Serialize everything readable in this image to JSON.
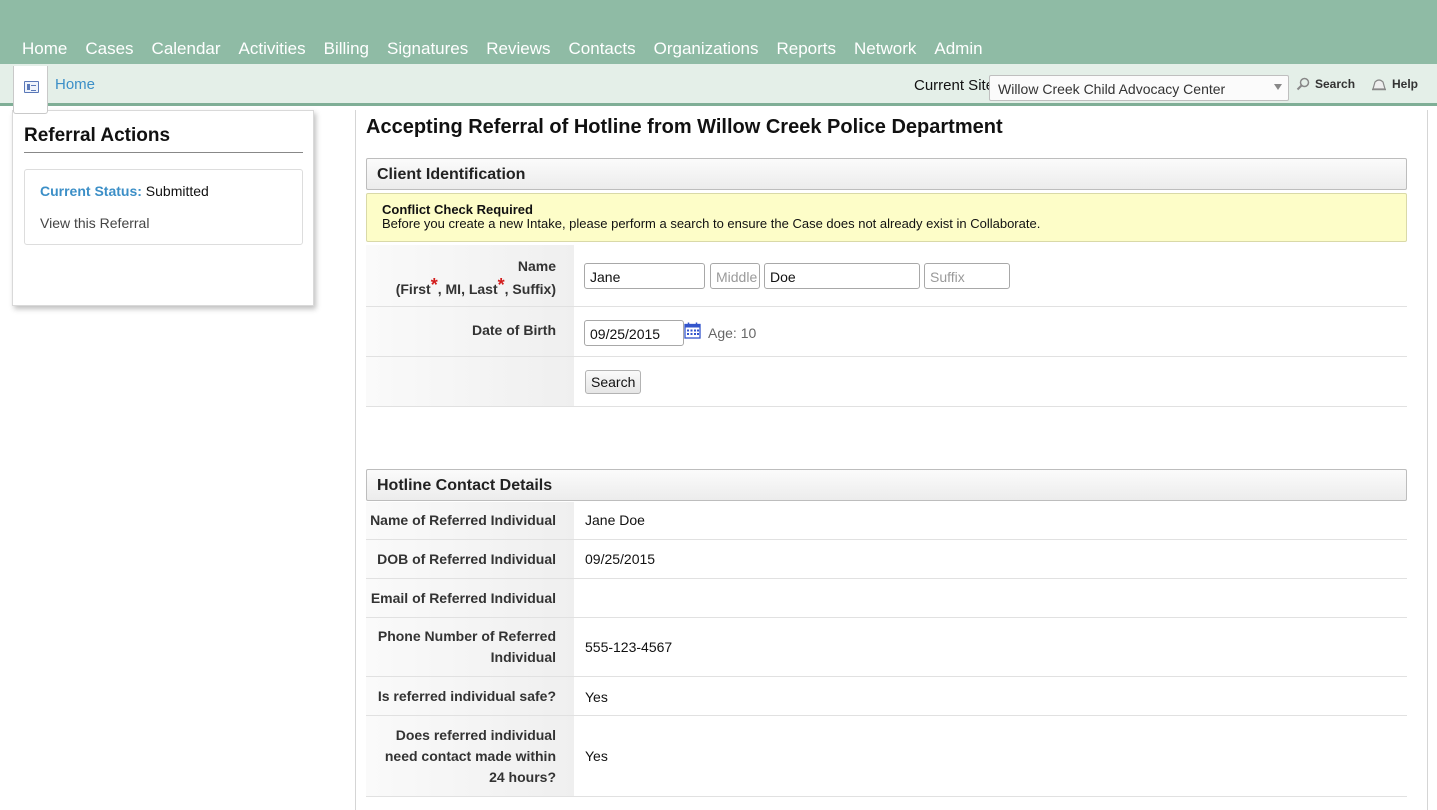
{
  "nav": {
    "items": [
      "Home",
      "Cases",
      "Calendar",
      "Activities",
      "Billing",
      "Signatures",
      "Reviews",
      "Contacts",
      "Organizations",
      "Reports",
      "Network",
      "Admin"
    ]
  },
  "header": {
    "breadcrumb": "Home",
    "current_site_label": "Current Site",
    "current_site_value": "Willow Creek Child Advocacy Center",
    "search_label": "Search",
    "help_label": "Help"
  },
  "sidebar": {
    "title": "Referral Actions",
    "status_key": "Current Status:",
    "status_value": "Submitted",
    "view_link": "View this Referral"
  },
  "main": {
    "title": "Accepting Referral of Hotline from Willow Creek Police Department",
    "client_section": {
      "title": "Client Identification",
      "warning_title": "Conflict Check Required",
      "warning_text": "Before you create a new Intake, please perform a search to ensure the Case does not already exist in Collaborate.",
      "name_label": "Name",
      "name_sub_first": "(First",
      "name_sub_mid": ", MI, Last",
      "name_sub_end": ", Suffix)",
      "first_name": "Jane",
      "middle_placeholder": "Middle",
      "last_name": "Doe",
      "suffix_placeholder": "Suffix",
      "dob_label": "Date of Birth",
      "dob_value": "09/25/2015",
      "age_text": "Age: 10",
      "search_button": "Search"
    },
    "hotline_section": {
      "title": "Hotline Contact Details",
      "rows": [
        {
          "label": "Name of Referred Individual",
          "value": "Jane Doe"
        },
        {
          "label": "DOB of Referred Individual",
          "value": "09/25/2015"
        },
        {
          "label": "Email of Referred Individual",
          "value": ""
        },
        {
          "label": "Phone Number of Referred Individual",
          "value": "555-123-4567"
        },
        {
          "label": "Is referred individual safe?",
          "value": "Yes"
        },
        {
          "label": "Does referred individual need contact made within 24 hours?",
          "value": "Yes"
        }
      ]
    }
  }
}
